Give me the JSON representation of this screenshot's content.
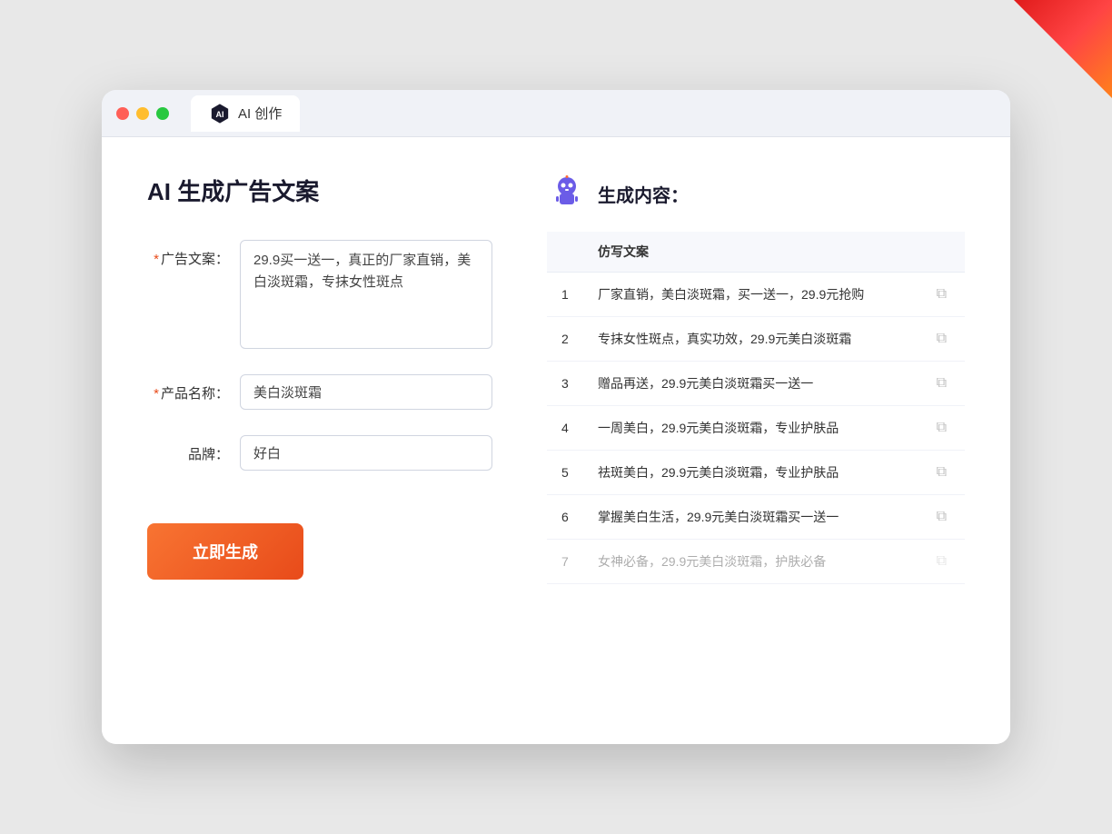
{
  "browser": {
    "tab_title": "AI 创作"
  },
  "page": {
    "title": "AI 生成广告文案",
    "result_title": "生成内容："
  },
  "form": {
    "ad_copy_label": "广告文案：",
    "ad_copy_required": "*",
    "ad_copy_value": "29.9买一送一，真正的厂家直销，美白淡斑霜，专抹女性斑点",
    "product_name_label": "产品名称：",
    "product_name_required": "*",
    "product_name_value": "美白淡斑霜",
    "brand_label": "品牌：",
    "brand_value": "好白",
    "generate_btn": "立即生成"
  },
  "table": {
    "column_header": "仿写文案",
    "rows": [
      {
        "num": "1",
        "text": "厂家直销，美白淡斑霜，买一送一，29.9元抢购"
      },
      {
        "num": "2",
        "text": "专抹女性斑点，真实功效，29.9元美白淡斑霜"
      },
      {
        "num": "3",
        "text": "赠品再送，29.9元美白淡斑霜买一送一"
      },
      {
        "num": "4",
        "text": "一周美白，29.9元美白淡斑霜，专业护肤品"
      },
      {
        "num": "5",
        "text": "祛斑美白，29.9元美白淡斑霜，专业护肤品"
      },
      {
        "num": "6",
        "text": "掌握美白生活，29.9元美白淡斑霜买一送一"
      },
      {
        "num": "7",
        "text": "女神必备，29.9元美白淡斑霜，护肤必备"
      }
    ]
  }
}
